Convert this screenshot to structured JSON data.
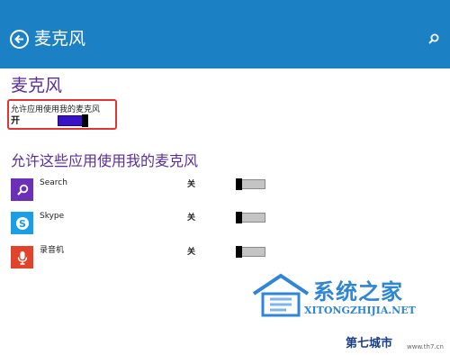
{
  "header": {
    "title": "麦克风",
    "back_icon": "back-arrow-icon",
    "search_icon": "search-icon",
    "color": "#1c80c4"
  },
  "section_title": "麦克风",
  "master": {
    "label": "允许应用使用我的麦克风",
    "state": "开",
    "on": true
  },
  "apps_heading": "允许这些应用使用我的麦克风",
  "apps": [
    {
      "name": "Search",
      "state": "关",
      "icon": "search-icon",
      "color": "#6b2fb8",
      "on": false
    },
    {
      "name": "Skype",
      "state": "关",
      "icon": "skype-icon",
      "color": "#1a9ee6",
      "on": false
    },
    {
      "name": "录音机",
      "state": "关",
      "icon": "microphone-icon",
      "color": "#e0442a",
      "on": false
    }
  ],
  "watermark": {
    "name": "系统之家",
    "url": "XITONGZHIJIA.NET",
    "corner_name": "第七城市",
    "corner_url": "www.th7.cn"
  },
  "colors": {
    "accent_purple": "#5b2d9e",
    "highlight_red": "#e23434",
    "toggle_on": "#3b10c9"
  }
}
